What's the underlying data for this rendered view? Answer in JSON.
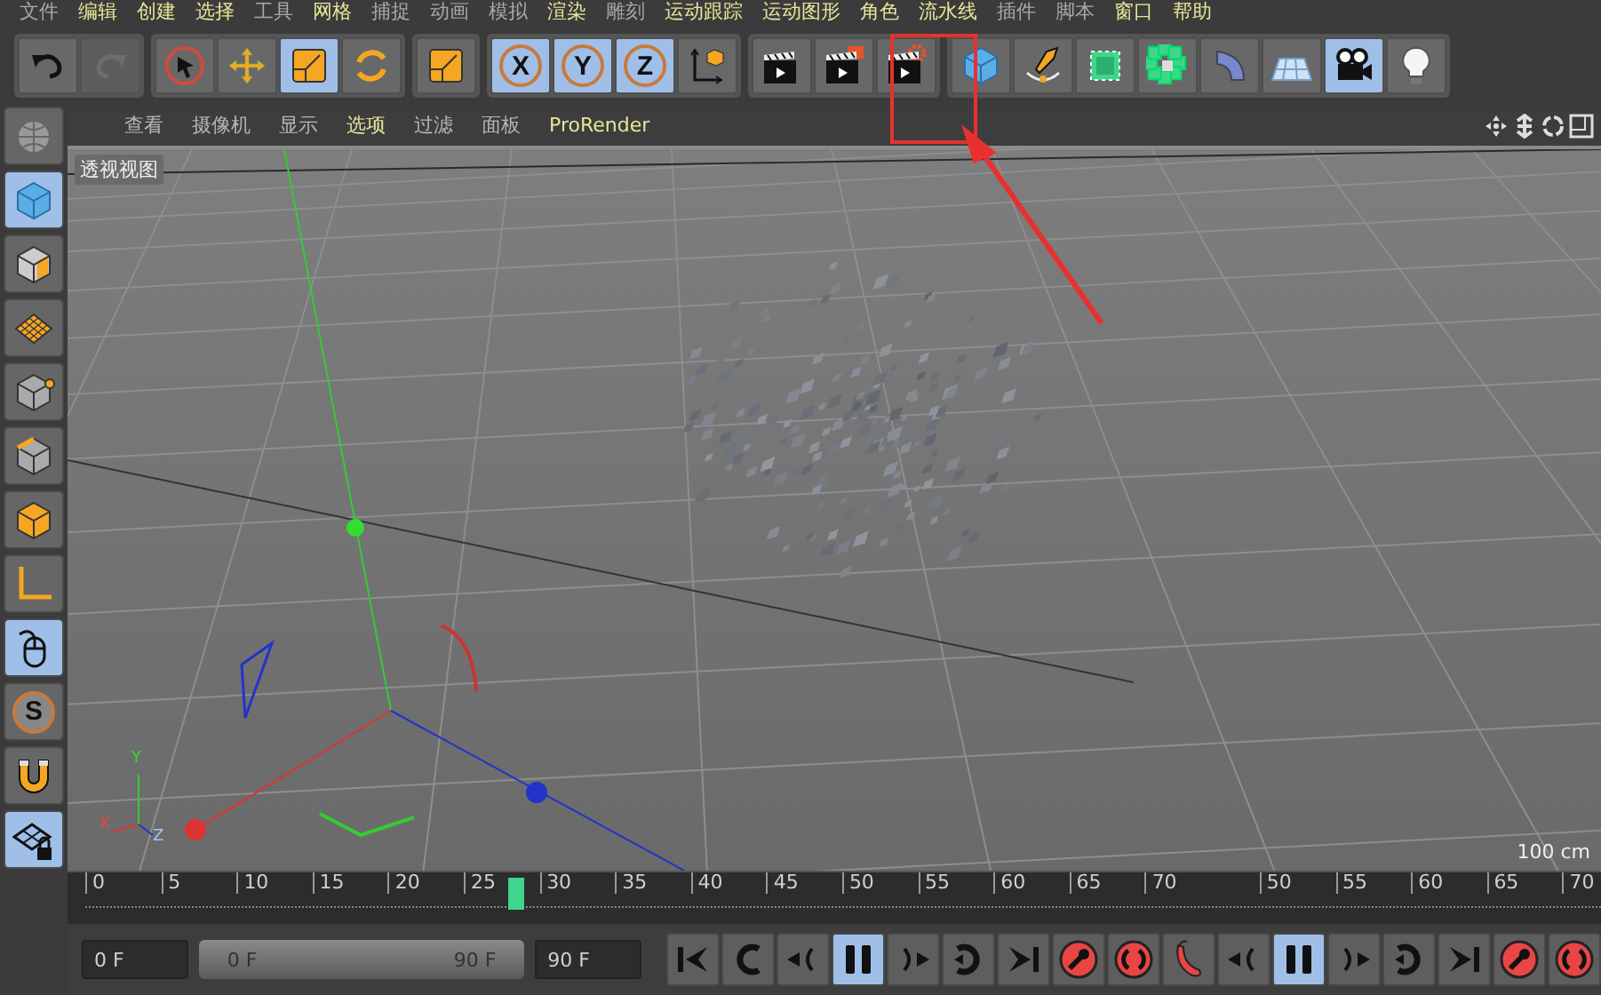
{
  "menu_bar": [
    {
      "label": "文件",
      "highlighted": false
    },
    {
      "label": "编辑",
      "highlighted": true
    },
    {
      "label": "创建",
      "highlighted": true
    },
    {
      "label": "选择",
      "highlighted": true
    },
    {
      "label": "工具",
      "highlighted": false
    },
    {
      "label": "网格",
      "highlighted": true
    },
    {
      "label": "捕捉",
      "highlighted": false
    },
    {
      "label": "动画",
      "highlighted": false
    },
    {
      "label": "模拟",
      "highlighted": false
    },
    {
      "label": "渲染",
      "highlighted": true
    },
    {
      "label": "雕刻",
      "highlighted": false
    },
    {
      "label": "运动跟踪",
      "highlighted": true
    },
    {
      "label": "运动图形",
      "highlighted": true
    },
    {
      "label": "角色",
      "highlighted": true
    },
    {
      "label": "流水线",
      "highlighted": true
    },
    {
      "label": "插件",
      "highlighted": false
    },
    {
      "label": "脚本",
      "highlighted": false
    },
    {
      "label": "窗口",
      "highlighted": true
    },
    {
      "label": "帮助",
      "highlighted": true
    }
  ],
  "toolbar": [
    [
      {
        "kind": "undo",
        "selected": false
      },
      {
        "kind": "redo",
        "selected": false,
        "disabled": true
      }
    ],
    [
      {
        "kind": "pointer",
        "selected": false
      },
      {
        "kind": "move",
        "selected": false
      },
      {
        "kind": "scale",
        "selected": true
      },
      {
        "kind": "rotate",
        "selected": false
      }
    ],
    [
      {
        "kind": "scale",
        "selected": false
      }
    ],
    [
      {
        "kind": "letter",
        "label": "X",
        "selected": true
      },
      {
        "kind": "letter",
        "label": "Y",
        "selected": true
      },
      {
        "kind": "letter",
        "label": "Z",
        "selected": true
      },
      {
        "kind": "axis-cube",
        "selected": false
      }
    ],
    [
      {
        "kind": "clapper",
        "selected": false
      },
      {
        "kind": "clapper-flag",
        "selected": false
      },
      {
        "kind": "clapper-gear",
        "selected": false
      }
    ],
    [
      {
        "kind": "cube",
        "selected": false
      },
      {
        "kind": "pen",
        "selected": false
      },
      {
        "kind": "green-cube",
        "selected": false
      },
      {
        "kind": "flower",
        "selected": false
      },
      {
        "kind": "bend",
        "selected": false
      },
      {
        "kind": "floor",
        "selected": false
      },
      {
        "kind": "camera",
        "selected": true
      },
      {
        "kind": "bulb",
        "selected": false
      }
    ]
  ],
  "sidebar": [
    {
      "kind": "globe",
      "selected": false
    },
    {
      "kind": "cube",
      "selected": true
    },
    {
      "kind": "checker",
      "selected": false
    },
    {
      "kind": "grid",
      "selected": false
    },
    {
      "kind": "cube-point",
      "selected": false
    },
    {
      "kind": "cube-edge",
      "selected": false
    },
    {
      "kind": "cube-poly",
      "selected": false
    },
    {
      "kind": "axis",
      "selected": false
    },
    {
      "kind": "mouse",
      "selected": true
    },
    {
      "kind": "letter",
      "label": "S",
      "selected": false
    },
    {
      "kind": "magnet",
      "selected": false
    },
    {
      "kind": "grid-lock",
      "selected": true
    }
  ],
  "viewport_menu": [
    {
      "label": "查看",
      "highlighted": false
    },
    {
      "label": "摄像机",
      "highlighted": false
    },
    {
      "label": "显示",
      "highlighted": false
    },
    {
      "label": "选项",
      "highlighted": true
    },
    {
      "label": "过滤",
      "highlighted": false
    },
    {
      "label": "面板",
      "highlighted": false
    },
    {
      "label": "ProRender",
      "highlighted": true
    }
  ],
  "viewport": {
    "title": "透视视图",
    "scale": "100 cm",
    "gizmo": {
      "y": "Y",
      "x": "X",
      "z": "Z"
    }
  },
  "timeline": {
    "ruler_segments": [
      [
        "0",
        "5",
        "10",
        "15",
        "20",
        "25",
        "30",
        "35",
        "40",
        "45",
        "50",
        "55",
        "60",
        "65",
        "70"
      ],
      [
        "50",
        "55",
        "60",
        "65",
        "70"
      ]
    ],
    "playhead": {
      "level": 0.287
    }
  },
  "controls": {
    "start": "0 F",
    "range": {
      "level": 1
    },
    "range_start": "0 F",
    "range_end": "90 F",
    "end": "90 F",
    "transport": [
      {
        "kind": "first",
        "selected": false
      },
      {
        "kind": "loop-left",
        "selected": false
      },
      {
        "kind": "step-back",
        "selected": false
      },
      {
        "kind": "pause",
        "selected": true
      },
      {
        "kind": "step-forward",
        "selected": false
      },
      {
        "kind": "loop-right",
        "selected": false
      },
      {
        "kind": "last",
        "selected": false
      },
      {
        "kind": "record-key",
        "selected": false
      },
      {
        "kind": "record-rotation",
        "selected": false
      },
      {
        "kind": "record-pepper",
        "selected": false
      },
      {
        "kind": "step-back",
        "selected": false
      },
      {
        "kind": "pause",
        "selected": true
      },
      {
        "kind": "step-forward",
        "selected": false
      },
      {
        "kind": "loop-right",
        "selected": false
      },
      {
        "kind": "last",
        "selected": false
      },
      {
        "kind": "record-key",
        "selected": false
      },
      {
        "kind": "record-rotation",
        "selected": false
      }
    ]
  }
}
